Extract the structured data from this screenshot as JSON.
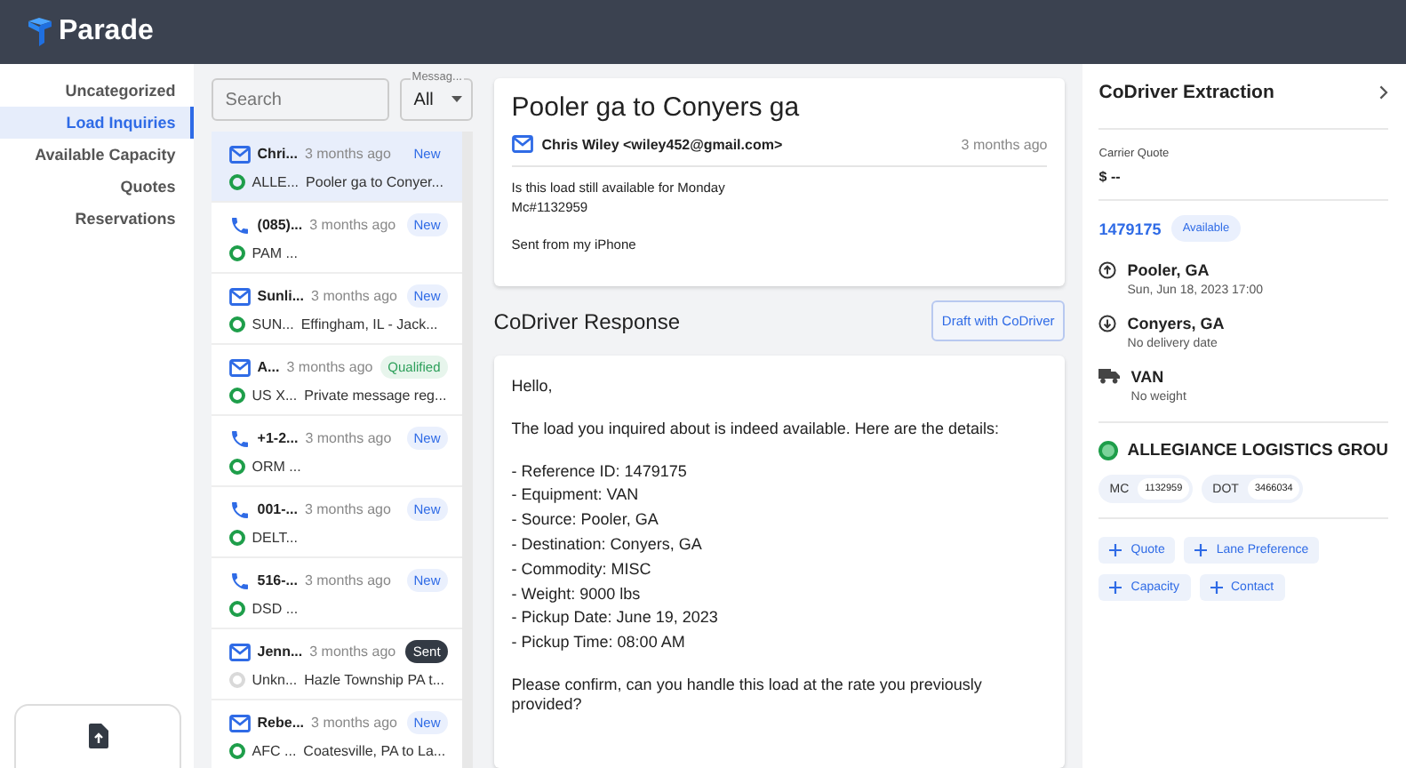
{
  "app": {
    "name": "Parade"
  },
  "sidebar": {
    "items": [
      {
        "label": "Uncategorized",
        "selected": false
      },
      {
        "label": "Load Inquiries",
        "selected": true
      },
      {
        "label": "Available Capacity",
        "selected": false
      },
      {
        "label": "Quotes",
        "selected": false
      },
      {
        "label": "Reservations",
        "selected": false
      }
    ]
  },
  "filters": {
    "search": {
      "placeholder": "Search"
    },
    "type_select": {
      "label": "Messag...",
      "value": "All"
    }
  },
  "inbox": [
    {
      "kind": "email",
      "sender": "Chri...",
      "time": "3 months ago",
      "badge": {
        "kind": "new",
        "label": "New"
      },
      "color": "#1e9e4a",
      "carrier": "ALLE...",
      "subject": "Pooler ga to Conyer...",
      "selected": true
    },
    {
      "kind": "phone",
      "sender": "(085)...",
      "time": "3 months ago",
      "badge": {
        "kind": "new",
        "label": "New"
      },
      "color": "#1e9e4a",
      "carrier": "PAM ...",
      "selected": false
    },
    {
      "kind": "email",
      "sender": "Sunli...",
      "time": "3 months ago",
      "badge": {
        "kind": "new",
        "label": "New"
      },
      "color": "#1e9e4a",
      "carrier": "SUN...",
      "subject": "Effingham, IL - Jack...",
      "selected": false
    },
    {
      "kind": "email",
      "sender": "A...",
      "time": "3 months ago",
      "badge": {
        "kind": "qualified",
        "label": "Qualified"
      },
      "color": "#1e9e4a",
      "carrier": "US X...",
      "subject": "Private message reg...",
      "selected": false
    },
    {
      "kind": "phone",
      "sender": "+1-2...",
      "time": "3 months ago",
      "badge": {
        "kind": "new",
        "label": "New"
      },
      "color": "#1e9e4a",
      "carrier": "ORM ...",
      "selected": false
    },
    {
      "kind": "phone",
      "sender": "001-...",
      "time": "3 months ago",
      "badge": {
        "kind": "new",
        "label": "New"
      },
      "color": "#1e9e4a",
      "carrier": "DELT...",
      "selected": false
    },
    {
      "kind": "phone",
      "sender": "516-...",
      "time": "3 months ago",
      "badge": {
        "kind": "new",
        "label": "New"
      },
      "color": "#1e9e4a",
      "carrier": "DSD ...",
      "selected": false
    },
    {
      "kind": "email",
      "sender": "Jenn...",
      "time": "3 months ago",
      "badge": {
        "kind": "sent",
        "label": "Sent"
      },
      "color": "#d9d9d9",
      "carrier": "Unkn...",
      "subject": "Hazle Township PA t...",
      "selected": false
    },
    {
      "kind": "email",
      "sender": "Rebe...",
      "time": "3 months ago",
      "badge": {
        "kind": "new",
        "label": "New"
      },
      "color": "#1e9e4a",
      "carrier": "AFC ...",
      "subject": "Coatesville, PA to La...",
      "selected": false
    }
  ],
  "message": {
    "subject": "Pooler ga to Conyers ga",
    "from": "Chris Wiley <wiley452@gmail.com>",
    "time": "3 months ago",
    "body": [
      [
        "Is this load still available for Monday",
        "Mc#1132959"
      ],
      [
        "Sent from my iPhone"
      ]
    ]
  },
  "response": {
    "title": "CoDriver Response",
    "button": "Draft with CoDriver",
    "paragraphs": [
      [
        "Hello,"
      ],
      [
        "The load you inquired about is indeed available. Here are the details:"
      ],
      [
        "- Reference ID: 1479175",
        "- Equipment: VAN",
        "- Source: Pooler, GA",
        "- Destination: Conyers, GA",
        "- Commodity: MISC",
        "- Weight: 9000 lbs",
        "- Pickup Date: June 19, 2023",
        "- Pickup Time: 08:00 AM"
      ],
      [
        "Please confirm, can you handle this load at the rate you previously provided?"
      ]
    ]
  },
  "extraction": {
    "title": "CoDriver Extraction",
    "quote_label": "Carrier Quote",
    "quote_value": "$ --",
    "load_id": "1479175",
    "load_status": "Available",
    "stops": [
      {
        "kind": "pickup",
        "place": "Pooler, GA",
        "detail": "Sun, Jun 18, 2023 17:00"
      },
      {
        "kind": "delivery",
        "place": "Conyers, GA",
        "detail": "No delivery date"
      },
      {
        "kind": "equipment",
        "place": "VAN",
        "detail": "No weight"
      }
    ],
    "carrier": {
      "name": "ALLEGIANCE LOGISTICS GROU",
      "color": "#1e9e4a",
      "ids": [
        {
          "label": "MC",
          "value": "1132959"
        },
        {
          "label": "DOT",
          "value": "3466034"
        }
      ]
    },
    "actions": [
      "Quote",
      "Lane Preference",
      "Capacity",
      "Contact"
    ]
  }
}
